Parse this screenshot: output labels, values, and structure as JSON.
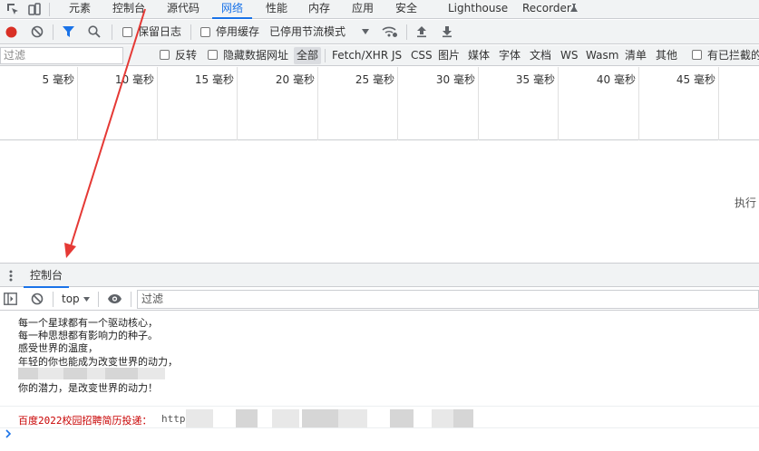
{
  "main_tabs": {
    "elements": "元素",
    "console": "控制台",
    "sources": "源代码",
    "network": "网络",
    "performance": "性能",
    "memory": "内存",
    "application": "应用",
    "security": "安全",
    "lighthouse": "Lighthouse",
    "recorder": "Recorder"
  },
  "network_toolbar": {
    "preserve_log": "保留日志",
    "disable_cache": "停用缓存",
    "throttling": "已停用节流模式"
  },
  "filter_bar": {
    "placeholder": "过滤",
    "invert": "反转",
    "hide_data_urls": "隐藏数据网址",
    "types": [
      "全部",
      "Fetch/XHR",
      "JS",
      "CSS",
      "图片",
      "媒体",
      "字体",
      "文档",
      "WS",
      "Wasm",
      "清单",
      "其他"
    ],
    "blocked_requests": "有已拦截的"
  },
  "timeline": {
    "ticks": [
      "5 毫秒",
      "10 毫秒",
      "15 毫秒",
      "20 毫秒",
      "25 毫秒",
      "30 毫秒",
      "35 毫秒",
      "40 毫秒",
      "45 毫秒"
    ]
  },
  "empty_state": {
    "text": "执行"
  },
  "drawer": {
    "tab": "控制台"
  },
  "console_toolbar": {
    "context": "top",
    "filter_placeholder": "过滤"
  },
  "console_log": {
    "lines": [
      "每一个星球都有一个驱动核心，",
      "每一种思想都有影响力的种子。",
      "感受世界的温度，",
      "年轻的你也能成为改变世界的动力，",
      "你的潜力，是改变世界的动力！"
    ],
    "recruit_prefix": "百度2022校园招聘简历投递：",
    "recruit_link_start": "http"
  },
  "colors": {
    "accent": "#1a73e8",
    "record": "#d93025",
    "annotation_arrow": "#e53935",
    "recruit_text": "#c80000"
  },
  "icons": [
    "inspect-icon",
    "device-toggle-icon",
    "record-icon",
    "clear-icon",
    "filter-icon",
    "search-icon",
    "dropdown-icon",
    "wifi-settings-icon",
    "upload-icon",
    "download-icon",
    "flask-icon",
    "drawer-menu-icon",
    "sidebar-toggle-icon",
    "eye-icon",
    "chevron-down-icon"
  ]
}
